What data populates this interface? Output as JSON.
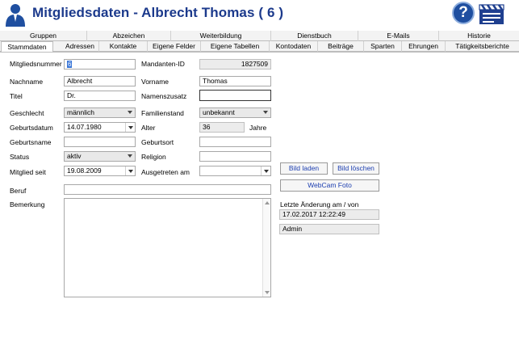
{
  "header": {
    "title": "Mitgliedsdaten - Albrecht Thomas ( 6 )",
    "help_label": "?",
    "accent": "#1c3a8c"
  },
  "tabs_row1": [
    "Gruppen",
    "Abzeichen",
    "Weiterbildung",
    "Dienstbuch",
    "E-Mails",
    "Historie"
  ],
  "tabs_row2": [
    "Stammdaten",
    "Adressen",
    "Kontakte",
    "Eigene Felder",
    "Eigene Tabellen",
    "Kontodaten",
    "Beiträge",
    "Sparten",
    "Ehrungen",
    "Tätigkeitsberichte"
  ],
  "form": {
    "mitgliedsnummer": {
      "label": "Mitgliedsnummer",
      "value": "6"
    },
    "mandanten_id": {
      "label": "Mandanten-ID",
      "value": "1827509"
    },
    "nachname": {
      "label": "Nachname",
      "value": "Albrecht"
    },
    "vorname": {
      "label": "Vorname",
      "value": "Thomas"
    },
    "titel": {
      "label": "Titel",
      "value": "Dr."
    },
    "namenszusatz": {
      "label": "Namenszusatz",
      "value": ""
    },
    "geschlecht": {
      "label": "Geschlecht",
      "value": "männlich"
    },
    "familienstand": {
      "label": "Familienstand",
      "value": "unbekannt"
    },
    "geburtsdatum": {
      "label": "Geburtsdatum",
      "value": "14.07.1980"
    },
    "alter": {
      "label": "Alter",
      "value": "36",
      "unit": "Jahre"
    },
    "geburtsname": {
      "label": "Geburtsname",
      "value": ""
    },
    "geburtsort": {
      "label": "Geburtsort",
      "value": ""
    },
    "status": {
      "label": "Status",
      "value": "aktiv"
    },
    "religion": {
      "label": "Religion",
      "value": ""
    },
    "mitglied_seit": {
      "label": "Mitglied seit",
      "value": "19.08.2009"
    },
    "ausgetreten_am": {
      "label": "Ausgetreten am",
      "value": ""
    },
    "beruf": {
      "label": "Beruf",
      "value": ""
    },
    "bemerkung": {
      "label": "Bemerkung",
      "value": ""
    }
  },
  "photo": {
    "load_label": "Bild laden",
    "delete_label": "Bild löschen",
    "webcam_label": "WebCam Foto"
  },
  "last_change": {
    "label": "Letzte Änderung am / von",
    "date": "17.02.2017 12:22:49",
    "user": "Admin"
  }
}
